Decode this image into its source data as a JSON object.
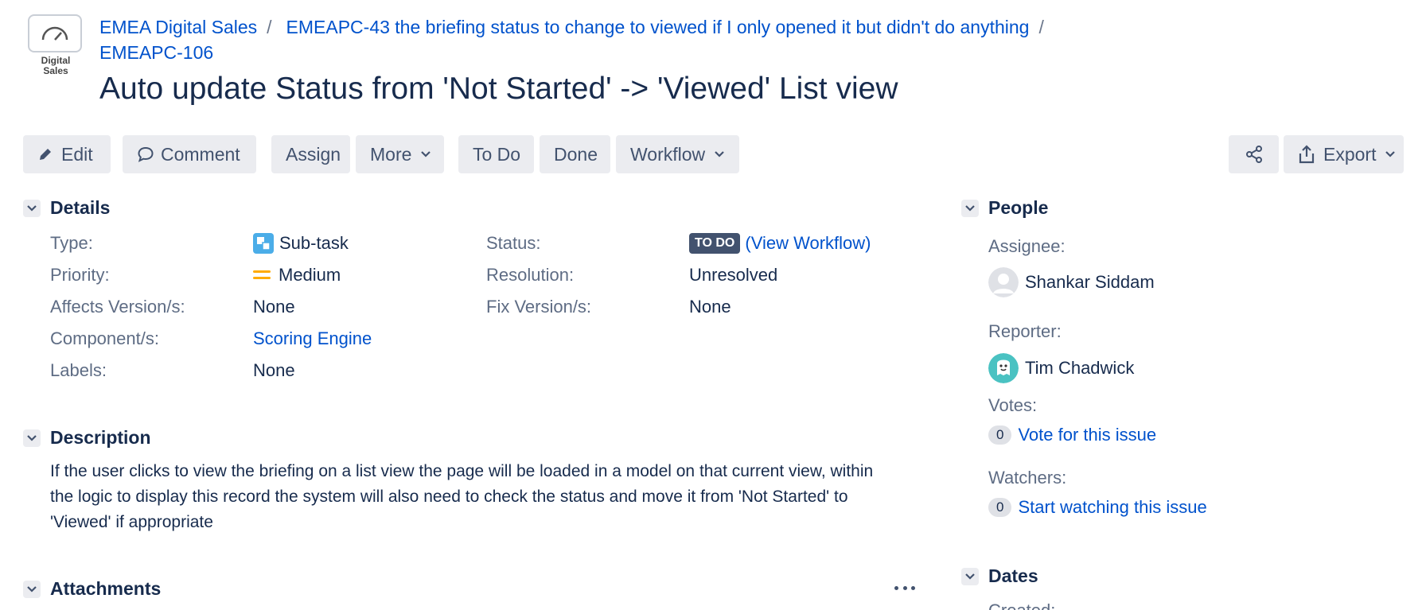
{
  "project": {
    "avatar_caption": "Digital Sales"
  },
  "breadcrumbs": {
    "project": "EMEA Digital Sales",
    "parent": "EMEAPC-43 the briefing status to change to viewed if I only opened it but didn't do anything",
    "issue_key": "EMEAPC-106",
    "separator": "/"
  },
  "issue": {
    "title": "Auto update Status from 'Not Started' -> 'Viewed' List view"
  },
  "toolbar": {
    "edit": "Edit",
    "comment": "Comment",
    "assign": "Assign",
    "more": "More",
    "todo": "To Do",
    "done": "Done",
    "workflow": "Workflow",
    "export": "Export"
  },
  "details": {
    "heading": "Details",
    "type_label": "Type:",
    "type_value": "Sub-task",
    "priority_label": "Priority:",
    "priority_value": "Medium",
    "affects_label": "Affects Version/s:",
    "affects_value": "None",
    "components_label": "Component/s:",
    "components_value": "Scoring Engine",
    "labels_label": "Labels:",
    "labels_value": "None",
    "status_label": "Status:",
    "status_value": "TO DO",
    "view_workflow": "(View Workflow)",
    "resolution_label": "Resolution:",
    "resolution_value": "Unresolved",
    "fix_label": "Fix Version/s:",
    "fix_value": "None"
  },
  "description": {
    "heading": "Description",
    "text": "If the user clicks to view the briefing on a list view the page will be loaded in a model on that current view, within the logic to display this record the system will also need to check the status and move it from 'Not Started' to 'Viewed' if appropriate"
  },
  "attachments": {
    "heading": "Attachments"
  },
  "people": {
    "heading": "People",
    "assignee_label": "Assignee:",
    "assignee": "Shankar Siddam",
    "reporter_label": "Reporter:",
    "reporter": "Tim Chadwick",
    "votes_label": "Votes:",
    "votes_count": "0",
    "vote_link": "Vote for this issue",
    "watchers_label": "Watchers:",
    "watchers_count": "0",
    "watch_link": "Start watching this issue"
  },
  "dates": {
    "heading": "Dates",
    "created_label": "Created:"
  },
  "colors": {
    "link": "#0052cc",
    "button_bg": "#ebecf0",
    "status_todo": "#42526e",
    "priority_medium": "#ffab00",
    "subtask_icon": "#4bade8"
  },
  "icons": [
    "gauge-icon",
    "pencil-icon",
    "comment-icon",
    "chevron-down-icon",
    "share-icon",
    "export-icon",
    "subtask-icon",
    "priority-medium-icon",
    "user-avatar",
    "reporter-avatar",
    "more-icon"
  ]
}
